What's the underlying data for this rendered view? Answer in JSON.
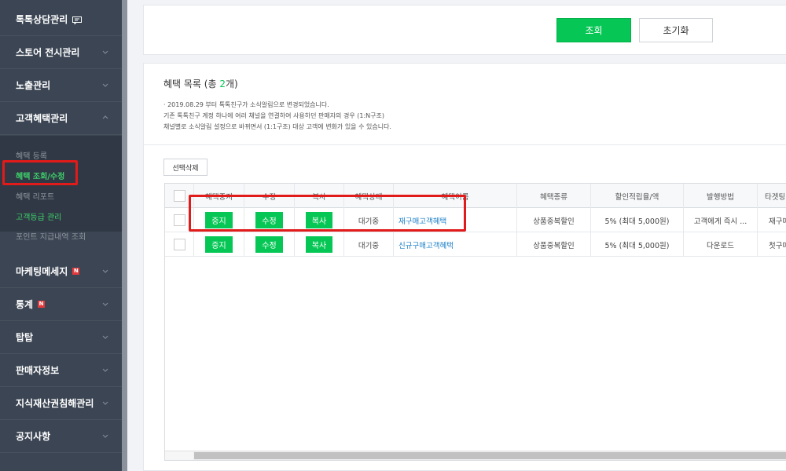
{
  "sidebar": {
    "items": [
      {
        "label": "톡톡상담관리",
        "icon": "chat-bubble-icon"
      },
      {
        "label": "스토어 전시관리"
      },
      {
        "label": "노출관리"
      },
      {
        "label": "고객혜택관리"
      },
      {
        "label": "마케팅메세지",
        "badge": "N"
      },
      {
        "label": "통계",
        "badge": "N"
      },
      {
        "label": "탑탑"
      },
      {
        "label": "판매자정보"
      },
      {
        "label": "지식재산권침해관리"
      },
      {
        "label": "공지사항"
      }
    ],
    "submenu": [
      {
        "label": "혜택 등록"
      },
      {
        "label": "혜택 조회/수정"
      },
      {
        "label": "혜택 리포트"
      },
      {
        "label": "고객등급 관리"
      },
      {
        "label": "포인트 지급내역 조회"
      }
    ]
  },
  "search_panel": {
    "search_label": "조회",
    "reset_label": "초기화"
  },
  "list": {
    "title_prefix": "혜택 목록 (총 ",
    "count": "2",
    "title_suffix": "개)",
    "notices": [
      "· 2019.08.29 부터 톡톡친구가 소식알림으로 변경되었습니다.",
      "기존 톡톡친구 계정 하나에 여러 채널을 연결하여 사용하던 판매자의 경우 (1:N구조)",
      "채널별로 소식알림 설정으로 바뀌면서 (1:1구조) 대상 고객에 변화가 있을 수 있습니다."
    ],
    "delete_label": "선택삭제"
  },
  "table": {
    "headers": [
      "혜택중지",
      "수정",
      "복사",
      "혜택상태",
      "혜택이름",
      "혜택종류",
      "할인적립율/액",
      "발행방법",
      "타겟팅"
    ],
    "rows": [
      {
        "stop": "중지",
        "edit": "수정",
        "copy": "복사",
        "status": "대기중",
        "name": "재구매고객혜택",
        "type": "상품중복할인",
        "rate": "5% (최대 5,000원)",
        "method": "고객에게 즉시 ...",
        "target": "재구매"
      },
      {
        "stop": "중지",
        "edit": "수정",
        "copy": "복사",
        "status": "대기중",
        "name": "신규구매고객혜택",
        "type": "상품중복할인",
        "rate": "5% (최대 5,000원)",
        "method": "다운로드",
        "target": "첫구매"
      }
    ]
  },
  "colors": {
    "accent": "#06c755",
    "highlight": "#e11a1a",
    "sidebar": "#3b4553",
    "link": "#1a7fc8"
  }
}
